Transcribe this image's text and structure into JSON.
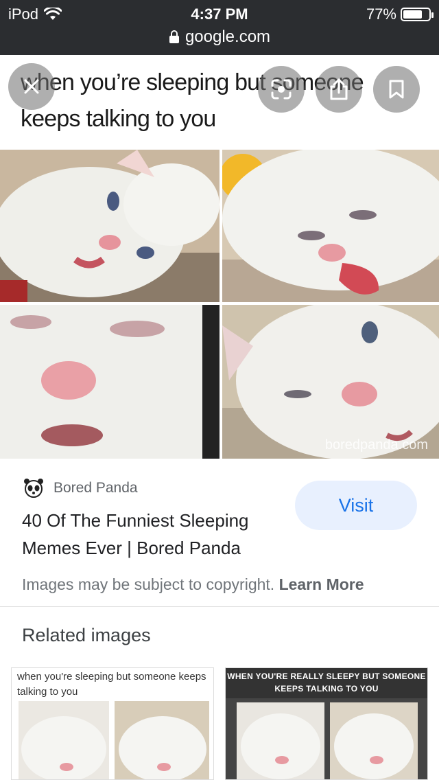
{
  "status_bar": {
    "carrier": "iPod",
    "time": "4:37 PM",
    "battery": "77%",
    "battery_level": 0.77
  },
  "url_bar": {
    "domain": "google.com"
  },
  "image": {
    "caption": "when you’re sleeping but someone keeps talking to you",
    "watermark": "boredpanda.com",
    "overlay_icons": [
      "close-icon",
      "lens-icon",
      "share-icon",
      "bookmark-icon"
    ]
  },
  "result": {
    "source": "Bored Panda",
    "title": "40 Of The Funniest Sleeping Memes Ever | Bored Panda",
    "visit_label": "Visit",
    "copyright_text": "Images may be subject to copyright.",
    "learn_more": "Learn More"
  },
  "related": {
    "heading": "Related images",
    "items": [
      {
        "caption": "when you're sleeping but someone keeps talking to you"
      },
      {
        "caption": "WHEN YOU'RE REALLY SLEEPY BUT SOMEONE KEEPS TALKING TO YOU"
      }
    ]
  },
  "colors": {
    "accent": "#1a73e8",
    "visit_bg": "#e8f0fe",
    "status_bar_bg": "#2b2d30"
  }
}
